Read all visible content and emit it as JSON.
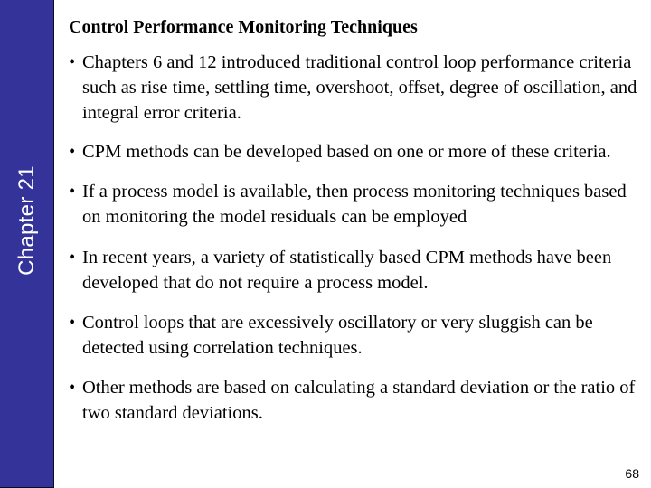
{
  "sidebar": {
    "label": "Chapter 21",
    "background_color": "#333399"
  },
  "slide": {
    "title": "Control Performance Monitoring Techniques",
    "bullet_glyph": "•",
    "bullets": [
      "Chapters 6 and 12 introduced traditional control loop performance criteria such as rise time, settling time, overshoot, offset, degree of oscillation, and integral error criteria.",
      "CPM methods can be developed based on one or more of these criteria.",
      "If a process model is available, then process monitoring techniques based on monitoring the model residuals can be employed",
      "In recent years, a variety of statistically based CPM methods have been developed that do not require a process model.",
      "Control loops that are excessively oscillatory or very sluggish can be detected using correlation techniques.",
      "Other methods are based on calculating a standard deviation or the ratio of two standard deviations."
    ],
    "page_number": "68"
  }
}
